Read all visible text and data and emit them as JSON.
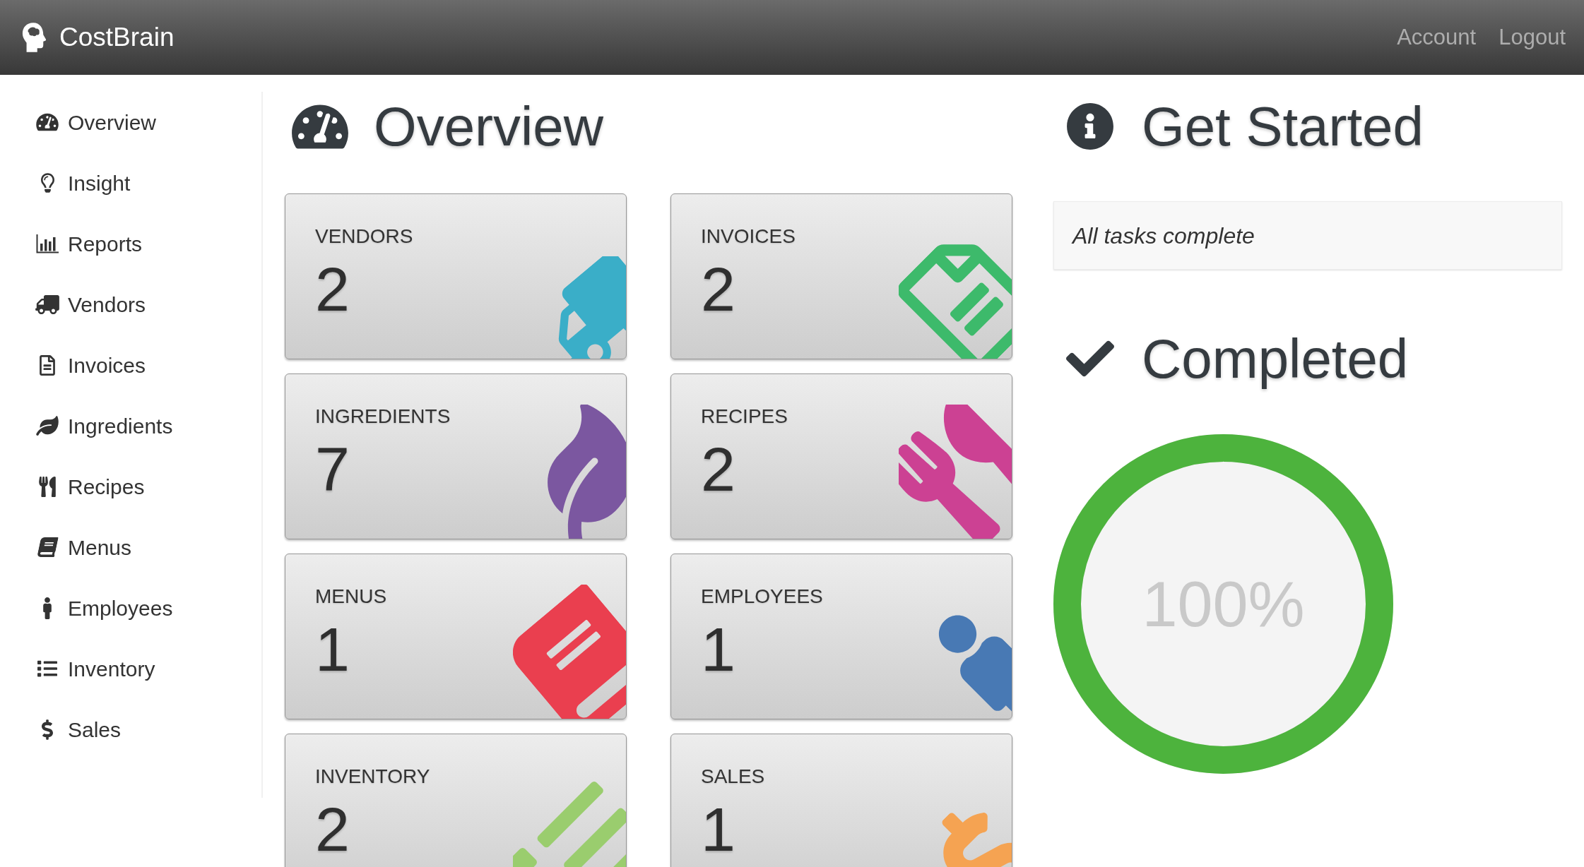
{
  "header": {
    "brand": "CostBrain",
    "links": [
      "Account",
      "Logout"
    ]
  },
  "sidebar": {
    "items": [
      "Overview",
      "Insight",
      "Reports",
      "Vendors",
      "Invoices",
      "Ingredients",
      "Recipes",
      "Menus",
      "Employees",
      "Inventory",
      "Sales"
    ]
  },
  "overview": {
    "title": "Overview",
    "cards": [
      {
        "label": "VENDORS",
        "count": "2",
        "color": "#3aaec8"
      },
      {
        "label": "INVOICES",
        "count": "2",
        "color": "#3dba6b"
      },
      {
        "label": "INGREDIENTS",
        "count": "7",
        "color": "#7b57a0"
      },
      {
        "label": "RECIPES",
        "count": "2",
        "color": "#cc4193"
      },
      {
        "label": "MENUS",
        "count": "1",
        "color": "#ea3f4f"
      },
      {
        "label": "EMPLOYEES",
        "count": "1",
        "color": "#4879b4"
      },
      {
        "label": "INVENTORY",
        "count": "2",
        "color": "#9acd6e"
      },
      {
        "label": "SALES",
        "count": "1",
        "color": "#f5a352"
      }
    ]
  },
  "get_started": {
    "title": "Get Started",
    "message": "All tasks complete"
  },
  "completed": {
    "title": "Completed",
    "progress": {
      "level": 1,
      "reading": "100%"
    }
  }
}
